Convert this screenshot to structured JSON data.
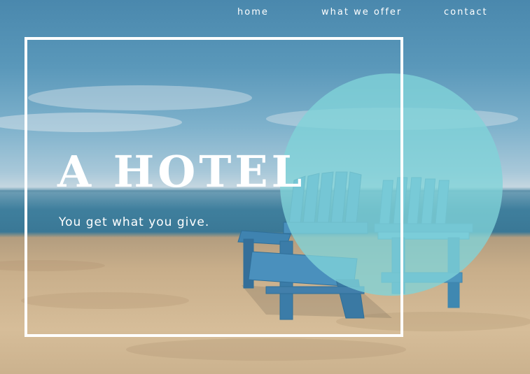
{
  "nav": {
    "items": [
      {
        "label": "home"
      },
      {
        "label": "what we offer"
      },
      {
        "label": "contact"
      }
    ]
  },
  "hero": {
    "title": "A HOTEL",
    "subtitle": "You get what you give.",
    "accent_circle_color": "#80d4d9",
    "frame_color": "#ffffff",
    "background_image": "beach with two blue adirondack chairs"
  }
}
